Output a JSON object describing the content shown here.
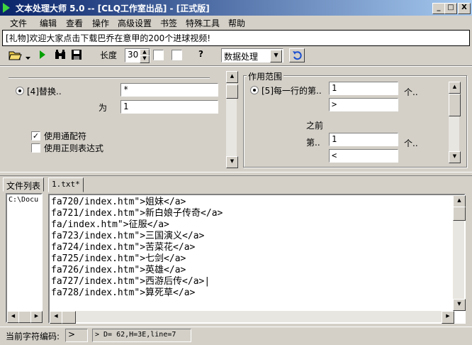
{
  "window": {
    "title": "文本处理大师 5.0 -- [CLQ工作室出品] - [正式版]",
    "min_label": "_",
    "max_label": "□",
    "close_label": "X"
  },
  "menu": [
    "文件",
    "编辑",
    "查看",
    "操作",
    "高级设置",
    "书签",
    "特殊工具",
    "帮助"
  ],
  "marquee": "[礼物]欢迎大家点击下载巴乔在意甲的200个进球视频!",
  "toolbar": {
    "length_label": "长度",
    "length_value": "30",
    "help_glyph": "?",
    "mode_value": "数据处理"
  },
  "left_panel": {
    "option_label": "[4]替换..",
    "find_value": "*",
    "with_label": "为",
    "with_value": "1",
    "wildcard_label": "使用通配符",
    "wildcard_checked": true,
    "regex_label": "使用正则表达式",
    "regex_checked": false
  },
  "right_panel": {
    "group_title": "作用范围",
    "option_label": "[5]每一行的第..",
    "n1_value": "1",
    "n1_unit": "个..",
    "s1_value": ">",
    "before_label": "之前",
    "nth_label": "第..",
    "n2_value": "1",
    "n2_unit": "个..",
    "s2_value": "<"
  },
  "file_list": {
    "tab_label": "文件列表",
    "items": [
      "C:\\Docu"
    ]
  },
  "editor": {
    "tab_label": "1.txt*",
    "lines": [
      "fa720/index.htm\">姐妹</a>",
      "fa721/index.htm\">新白娘子传奇</a>",
      "fa/index.htm\">征服</a>",
      "fa723/index.htm\">三国演义</a>",
      "fa724/index.htm\">苦菜花</a>",
      "fa725/index.htm\">七剑</a>",
      "fa726/index.htm\">英雄</a>",
      "fa727/index.htm\">西游后传</a>|",
      "fa728/index.htm\">算死草</a>"
    ]
  },
  "status": {
    "encoding_label": "当前字符编码:",
    "encoding_value": ">",
    "info": "> D= 62,H=3E,line=7"
  },
  "colors": {
    "title_start": "#0a246a",
    "title_end": "#a6caf0",
    "face": "#d4d0c8"
  }
}
